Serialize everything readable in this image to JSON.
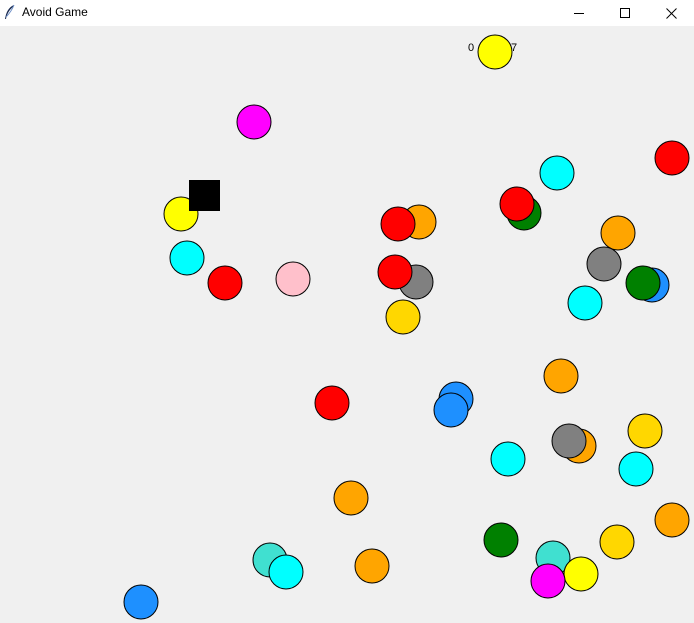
{
  "window": {
    "title": "Avoid Game",
    "icon": "feather-icon"
  },
  "controls": {
    "minimize_icon": "minimize-icon",
    "maximize_icon": "maximize-icon",
    "close_icon": "close-icon"
  },
  "score": {
    "left_text": "0",
    "right_text": "7"
  },
  "player": {
    "color": "#000000"
  },
  "balls": [
    {
      "color": "#ffff00"
    },
    {
      "color": "#ff00ff"
    },
    {
      "color": "#ff0000"
    },
    {
      "color": "#00ffff"
    },
    {
      "color": "#008000"
    },
    {
      "color": "#ff0000"
    },
    {
      "color": "#ffa500"
    },
    {
      "color": "#ff0000"
    },
    {
      "color": "#ffff00"
    },
    {
      "color": "#ffa500"
    },
    {
      "color": "#808080"
    },
    {
      "color": "#00ffff"
    },
    {
      "color": "#ff0000"
    },
    {
      "color": "#ffc0cb"
    },
    {
      "color": "#808080"
    },
    {
      "color": "#ff0000"
    },
    {
      "color": "#1e90ff"
    },
    {
      "color": "#008000"
    },
    {
      "color": "#00ffff"
    },
    {
      "color": "#ffd700"
    },
    {
      "color": "#ffa500"
    },
    {
      "color": "#ff0000"
    },
    {
      "color": "#1e90ff"
    },
    {
      "color": "#1e90ff"
    },
    {
      "color": "#ffd700"
    },
    {
      "color": "#ffa500"
    },
    {
      "color": "#808080"
    },
    {
      "color": "#00ffff"
    },
    {
      "color": "#00ffff"
    },
    {
      "color": "#ffa500"
    },
    {
      "color": "#ffa500"
    },
    {
      "color": "#008000"
    },
    {
      "color": "#ffd700"
    },
    {
      "color": "#40e0d0"
    },
    {
      "color": "#40e0d0"
    },
    {
      "color": "#00ffff"
    },
    {
      "color": "#ffa500"
    },
    {
      "color": "#ffff00"
    },
    {
      "color": "#ff00ff"
    },
    {
      "color": "#1e90ff"
    }
  ]
}
